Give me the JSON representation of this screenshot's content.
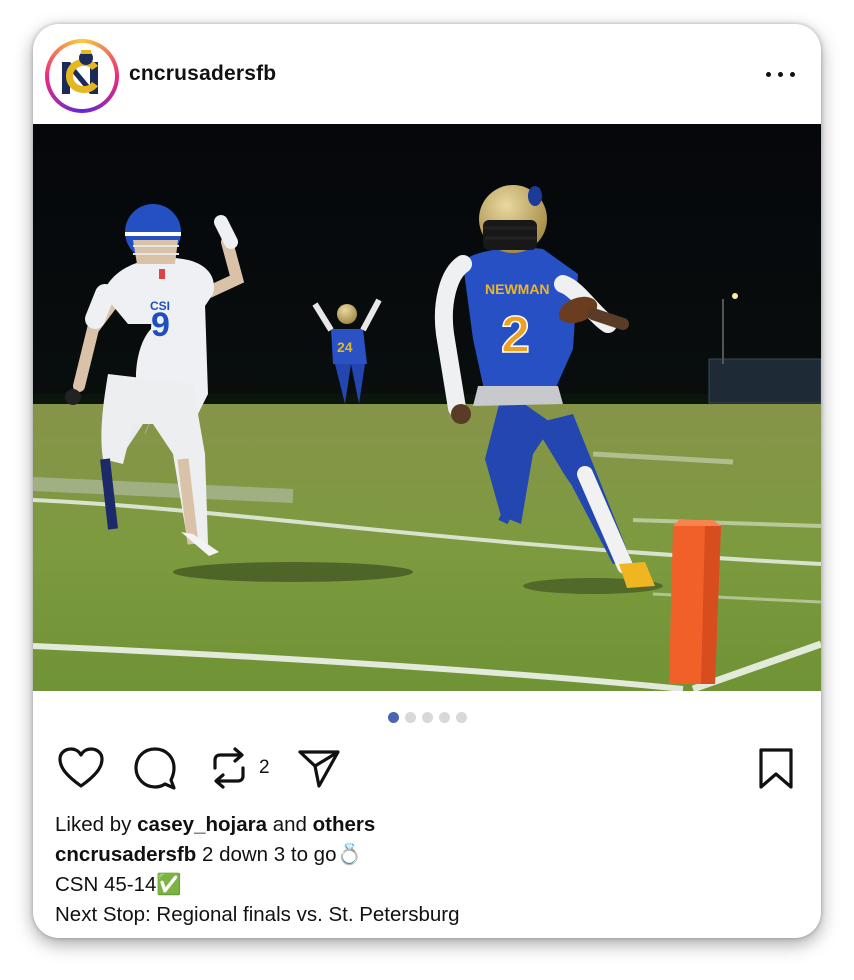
{
  "post": {
    "username": "cncrusadersfb",
    "repost_count": "2",
    "image_count": 5,
    "current_image": 1,
    "liked_by_prefix": "Liked by ",
    "liked_by_user": "casey_hojara",
    "liked_by_and": " and ",
    "liked_by_others": "others",
    "caption_user": "cncrusadersfb",
    "caption_line1": " 2 down 3 to go💍",
    "caption_line2": "CSN 45-14✅",
    "caption_line3": "Next Stop: Regional finals vs. St. Petersburg"
  },
  "photo": {
    "jersey_left_number": "9",
    "jersey_left_text": "CSI",
    "jersey_right_text": "NEWMAN",
    "jersey_right_number": "2",
    "jersey_back_number": "24"
  },
  "colors": {
    "pagination_active": "#4c63b6",
    "pagination_inactive": "#d8d8dc",
    "pylon": "#f2602a"
  },
  "icons": [
    "heart-icon",
    "comment-icon",
    "repost-icon",
    "share-icon",
    "bookmark-icon",
    "more-icon"
  ]
}
